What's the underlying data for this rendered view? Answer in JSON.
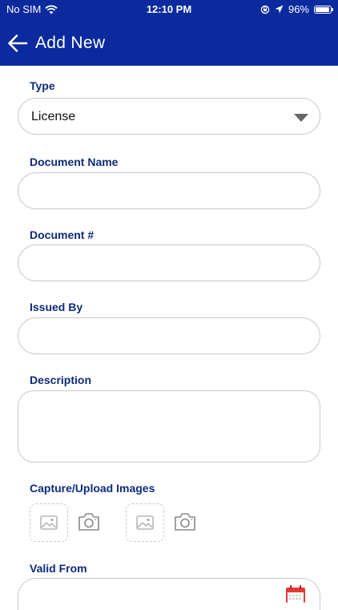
{
  "status": {
    "carrier": "No SIM",
    "time": "12:10 PM",
    "battery": "96%"
  },
  "nav": {
    "title": "Add New"
  },
  "form": {
    "type_label": "Type",
    "type_value": "License",
    "doc_name_label": "Document Name",
    "doc_name_value": "",
    "doc_number_label": "Document #",
    "doc_number_value": "",
    "issued_by_label": "Issued By",
    "issued_by_value": "",
    "description_label": "Description",
    "description_value": "",
    "images_label": "Capture/Upload Images",
    "valid_from_label": "Valid From",
    "valid_from_value": ""
  },
  "colors": {
    "brand": "#0a2a9e",
    "label": "#0d2b7a",
    "border": "#c9c9c9",
    "calendar": "#e53935"
  },
  "icons": [
    "wifi-icon",
    "rotation-lock-icon",
    "location-arrow-icon",
    "battery-icon",
    "back-arrow-icon",
    "caret-down-icon",
    "image-placeholder-icon",
    "camera-icon",
    "calendar-icon"
  ]
}
